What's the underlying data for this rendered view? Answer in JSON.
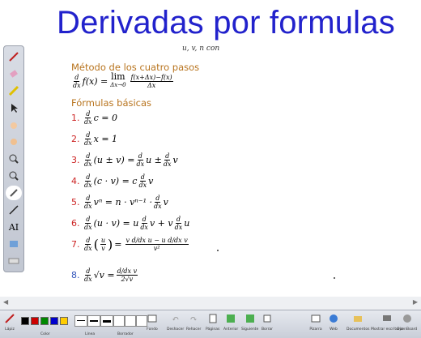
{
  "title": "Derivadas por formulas",
  "cutoff_text": "u, v, n    con",
  "definition_heading": "Método de los cuatro pasos",
  "definition": {
    "d": "d",
    "dx": "dx",
    "lhs": "f(x) =",
    "lim": "lim",
    "lim_sub": "Δx→0",
    "num": "f(x+Δx)−f(x)",
    "den": "Δx"
  },
  "basic_heading": "Fórmulas básicas",
  "formulas": [
    {
      "n": "1.",
      "parts": [
        "c = 0"
      ]
    },
    {
      "n": "2.",
      "parts": [
        "x = 1"
      ]
    },
    {
      "n": "3.",
      "parts": [
        "(u ± v) =",
        "u ±",
        "v"
      ]
    },
    {
      "n": "4.",
      "parts": [
        "(c · v) = c",
        "v"
      ]
    },
    {
      "n": "5.",
      "parts": [
        "vⁿ = n · vⁿ⁻¹ ·",
        "v"
      ]
    },
    {
      "n": "6.",
      "parts": [
        "(u · v) = u",
        "v + v",
        "u"
      ]
    },
    {
      "n": "7.",
      "parts": [
        "u",
        "v",
        "v²"
      ]
    },
    {
      "n": "8.",
      "parts": [
        "√v ="
      ]
    }
  ],
  "frac_d": "d",
  "frac_dx": "dx",
  "f7_num": "v d/dx u − u d/dx v",
  "f8_num": "d/dx v",
  "f8_den": "2√v",
  "toolbar_colors": [
    "#000000",
    "#cc0000",
    "#008800",
    "#0000cc",
    "#ffcc00"
  ],
  "bottom_labels": {
    "color_prefix": "Lápiz",
    "color": "Color",
    "linea": "Línea",
    "borrador": "Borrador",
    "fondo": "Fondo",
    "deshacer": "Deshacer",
    "rehacer": "Rehacer",
    "paginas": "Páginas",
    "anterior": "Anterior",
    "siguiente": "Siguiente",
    "borrar": "Borrar",
    "pizarra": "Pizarra",
    "web": "Web",
    "documentos": "Documentos",
    "mostrar": "Mostrar escritorio",
    "openboard": "OpenBoard"
  }
}
